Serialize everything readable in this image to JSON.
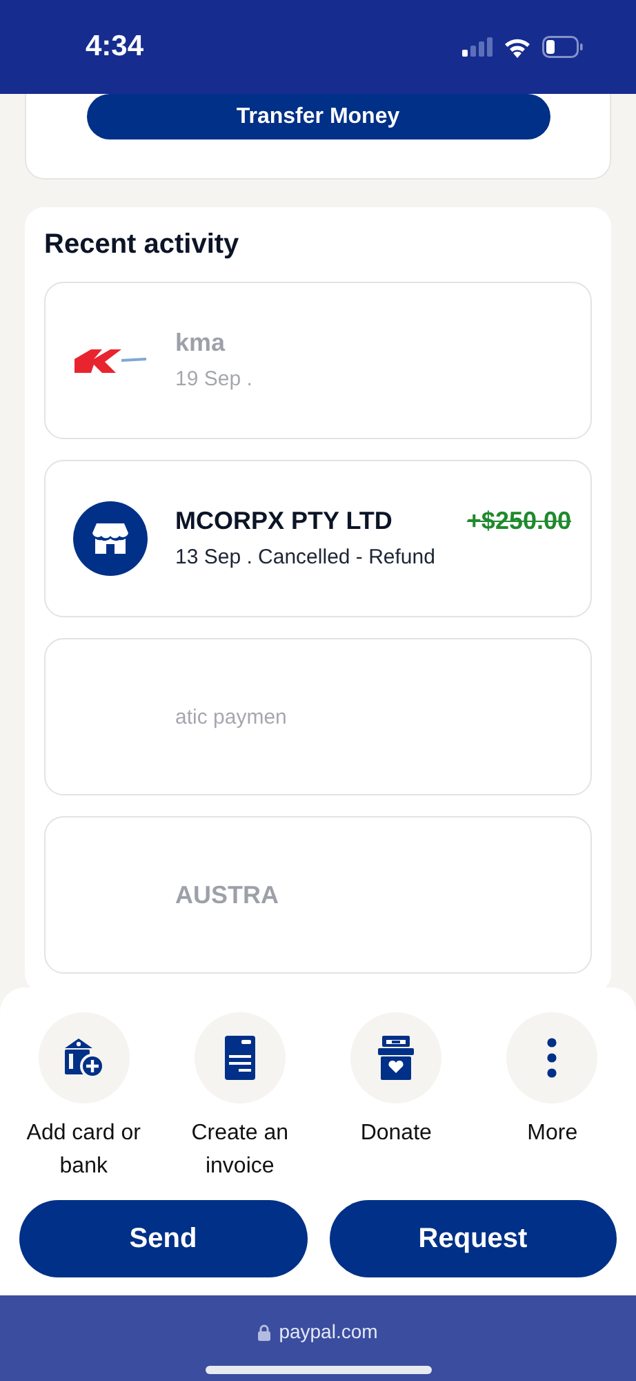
{
  "status_bar": {
    "time": "4:34"
  },
  "transfer_button": "Transfer Money",
  "recent_activity": {
    "title": "Recent activity",
    "items": [
      {
        "kind": "logo",
        "name": "kma",
        "detail": "19 Sep .",
        "faded": true
      },
      {
        "kind": "store",
        "name": "MCORPX PTY LTD",
        "detail": "13 Sep . Cancelled - Refund",
        "amount": "+$250.00",
        "cancelled": true,
        "faded": false
      },
      {
        "kind": "blank",
        "detail": "atic paymen",
        "faded": true
      },
      {
        "kind": "blank",
        "name": "AUSTRA",
        "faded": true
      }
    ]
  },
  "actions": [
    {
      "kind": "bank",
      "label": "Add card or bank"
    },
    {
      "kind": "invoice",
      "label": "Create an invoice"
    },
    {
      "kind": "donate",
      "label": "Donate"
    },
    {
      "kind": "more",
      "label": "More"
    }
  ],
  "buttons": [
    "Send",
    "Request"
  ],
  "browser_bar": {
    "url": "paypal.com"
  }
}
